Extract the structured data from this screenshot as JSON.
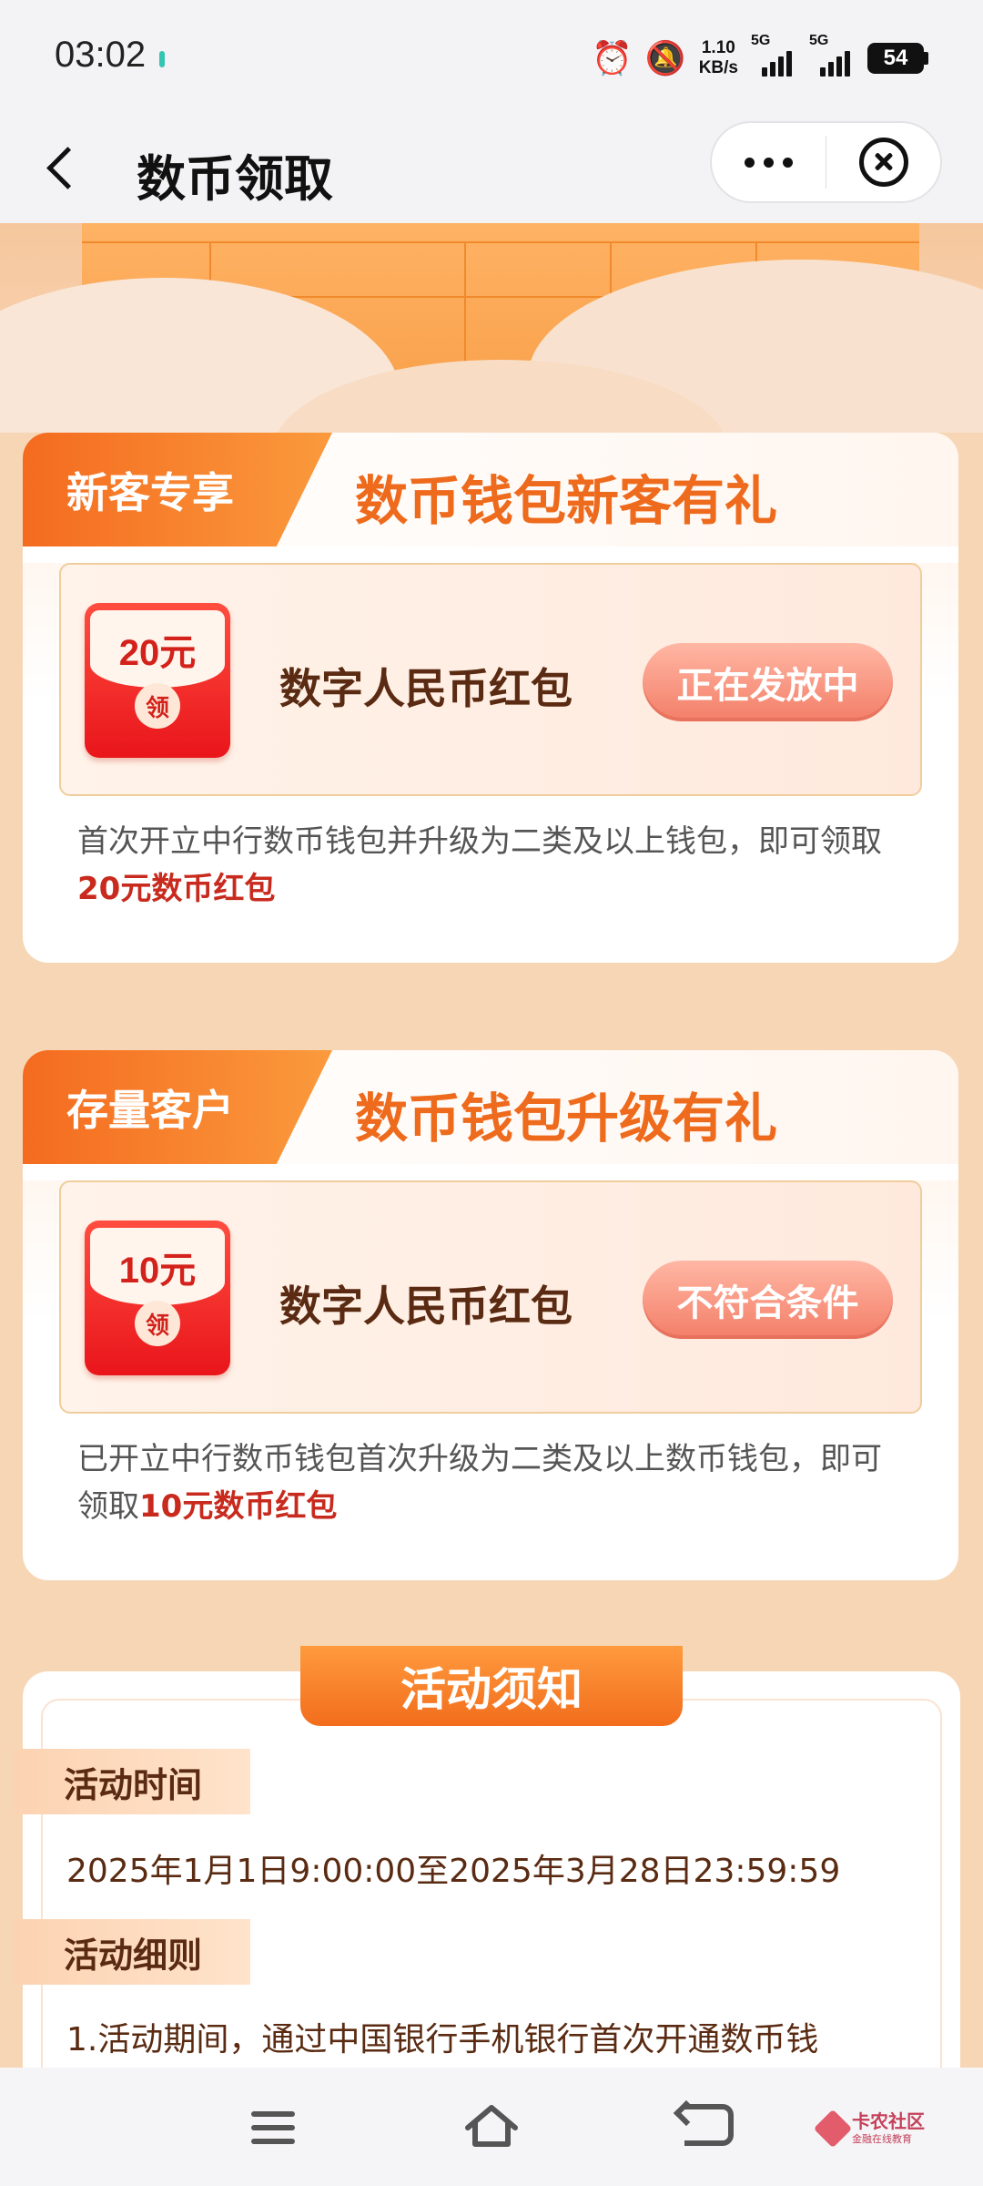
{
  "status_bar": {
    "time": "03:02",
    "net_speed_value": "1.10",
    "net_speed_unit": "KB/s",
    "signal1_label": "5G",
    "signal2_label": "5G",
    "battery": "54"
  },
  "header": {
    "title": "数币领取"
  },
  "card1": {
    "tag": "新客专享",
    "title": "数币钱包新客有礼",
    "amount": "20元",
    "seal": "领",
    "prize_name": "数字人民币红包",
    "status": "正在发放中",
    "desc_text": "首次开立中行数币钱包并升级为二类及以上钱包，即可领取",
    "desc_highlight": "20元数币红包"
  },
  "card2": {
    "tag": "存量客户",
    "title": "数币钱包升级有礼",
    "amount": "10元",
    "seal": "领",
    "prize_name": "数字人民币红包",
    "status": "不符合条件",
    "desc_text": "已开立中行数币钱包首次升级为二类及以上数币钱包，即可领取",
    "desc_highlight": "10元数币红包"
  },
  "notice": {
    "title": "活动须知",
    "time_label": "活动时间",
    "time_value": "2025年1月1日9:00:00至2025年3月28日23:59:59",
    "rules_label": "活动细则",
    "rules_line1": "1.活动期间，通过中国银行手机银行首次开通数币钱"
  },
  "watermark": {
    "name": "卡农社区",
    "sub": "金融在线教育"
  }
}
